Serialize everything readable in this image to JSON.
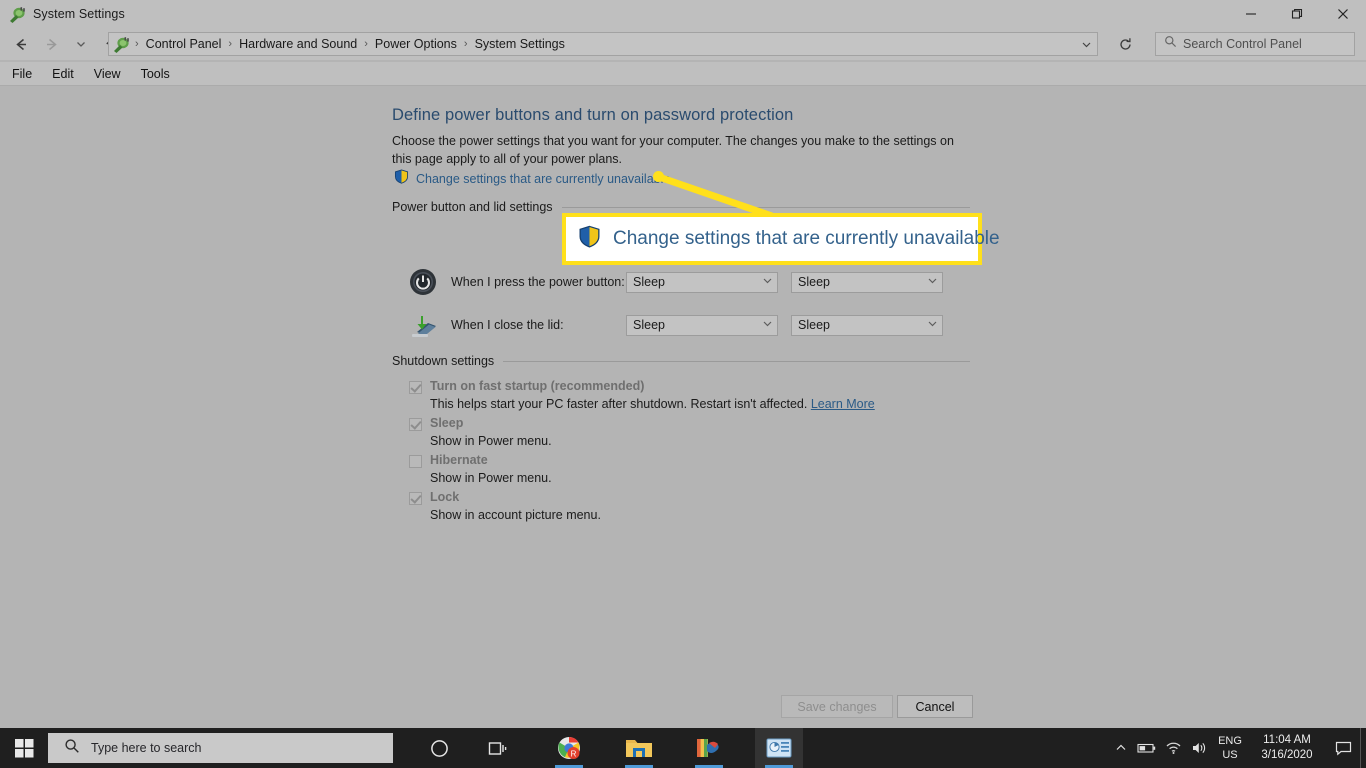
{
  "window": {
    "title": "System Settings",
    "icon": "power-plug-icon",
    "controls": {
      "minimize": "minimize-icon",
      "maximize": "maximize-icon",
      "close": "close-icon"
    }
  },
  "nav": {
    "back": "back-arrow-icon",
    "forward": "forward-arrow-icon",
    "recent": "recent-locations-icon",
    "up": "up-arrow-icon",
    "refresh": "refresh-icon",
    "breadcrumbs": [
      "Control Panel",
      "Hardware and Sound",
      "Power Options",
      "System Settings"
    ],
    "separator": "›",
    "search_placeholder": "Search Control Panel"
  },
  "menubar": {
    "items": [
      "File",
      "Edit",
      "View",
      "Tools"
    ]
  },
  "main": {
    "title": "Define power buttons and turn on password protection",
    "description": "Choose the power settings that you want for your computer. The changes you make to the settings on this page apply to all of your power plans.",
    "uac_link": "Change settings that are currently unavailable",
    "groups": {
      "power_lid": "Power button and lid settings",
      "shutdown": "Shutdown settings"
    },
    "settings": [
      {
        "icon": "power-button-icon",
        "label": "When I press the power button:",
        "battery_value": "Sleep",
        "plugged_value": "Sleep"
      },
      {
        "icon": "laptop-lid-icon",
        "label": "When I close the lid:",
        "battery_value": "Sleep",
        "plugged_value": "Sleep"
      }
    ],
    "checkboxes": [
      {
        "label": "Turn on fast startup (recommended)",
        "checked": true,
        "sub": "This helps start your PC faster after shutdown. Restart isn't affected.",
        "link": "Learn More"
      },
      {
        "label": "Sleep",
        "checked": true,
        "sub": "Show in Power menu.",
        "link": ""
      },
      {
        "label": "Hibernate",
        "checked": false,
        "sub": "Show in Power menu.",
        "link": ""
      },
      {
        "label": "Lock",
        "checked": true,
        "sub": "Show in account picture menu.",
        "link": ""
      }
    ],
    "buttons": {
      "save": "Save changes",
      "cancel": "Cancel"
    }
  },
  "callout": {
    "text": "Change settings that are currently unavailable",
    "icon": "uac-shield-icon",
    "border_color": "#ffe01b"
  },
  "taskbar": {
    "start": "windows-logo-icon",
    "search_placeholder": "Type here to search",
    "cortana": "cortana-circle-icon",
    "taskview": "task-view-icon",
    "apps": [
      "chrome-icon",
      "file-explorer-icon",
      "paint-icon",
      "control-panel-icon"
    ],
    "tray": {
      "overflow": "chevron-up-icon",
      "battery": "battery-icon",
      "network": "wifi-icon",
      "volume": "speaker-icon",
      "language_top": "ENG",
      "language_bottom": "US",
      "time": "11:04 AM",
      "date": "3/16/2020",
      "action_center": "action-center-icon"
    }
  },
  "colors": {
    "window_bg": "#b4b4b4",
    "chrome_bg": "#bfbfbf",
    "title_blue": "#2a4b6e",
    "link_blue": "#2a5a86",
    "highlight_yellow": "#ffe01b",
    "taskbar_bg": "#1f1f1f"
  }
}
